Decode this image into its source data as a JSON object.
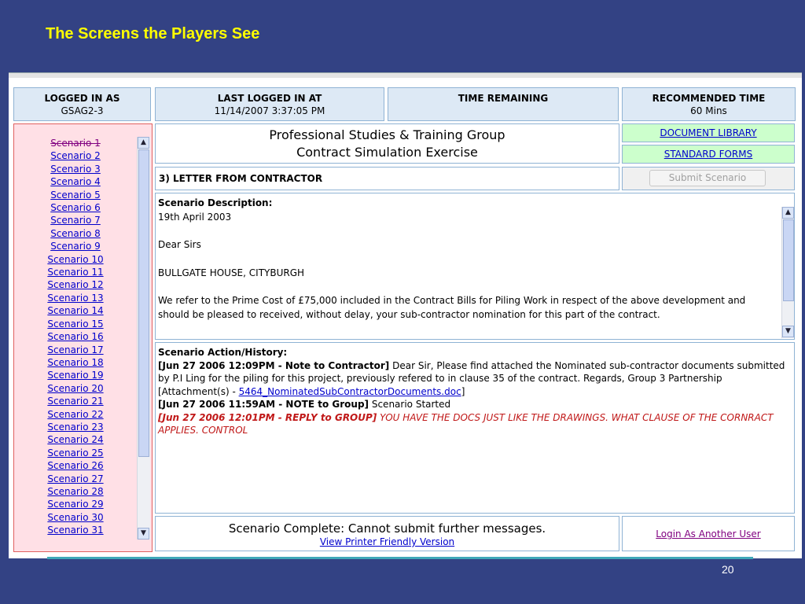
{
  "slide": {
    "title": "The Screens the Players See",
    "page_number": "20"
  },
  "header": {
    "logged_in_as": {
      "label": "LOGGED IN AS",
      "value": "GSAG2-3"
    },
    "last_logged_in": {
      "label": "LAST LOGGED IN AT",
      "value": "11/14/2007 3:37:05 PM"
    },
    "time_remaining": {
      "label": "TIME REMAINING",
      "value": ""
    },
    "recommended_time": {
      "label": "RECOMMENDED TIME",
      "value": "60 Mins"
    }
  },
  "sidebar": {
    "scenarios": [
      "Scenario 1",
      "Scenario 2",
      "Scenario 3",
      "Scenario 4",
      "Scenario 5",
      "Scenario 6",
      "Scenario 7",
      "Scenario 8",
      "Scenario 9",
      "Scenario 10",
      "Scenario 11",
      "Scenario 12",
      "Scenario 13",
      "Scenario 14",
      "Scenario 15",
      "Scenario 16",
      "Scenario 17",
      "Scenario 18",
      "Scenario 19",
      "Scenario 20",
      "Scenario 21",
      "Scenario 22",
      "Scenario 23",
      "Scenario 24",
      "Scenario 25",
      "Scenario 26",
      "Scenario 27",
      "Scenario 28",
      "Scenario 29",
      "Scenario 30",
      "Scenario 31"
    ]
  },
  "main": {
    "title_line1": "Professional Studies & Training Group",
    "title_line2": "Contract Simulation Exercise",
    "letter_heading": "3) LETTER FROM CONTRACTOR",
    "description": {
      "heading": "Scenario Description:",
      "date": "19th April 2003",
      "salutation": "Dear Sirs",
      "subject": "BULLGATE HOUSE, CITYBURGH",
      "body": "We refer to the Prime Cost of £75,000 included in the Contract Bills for Piling Work in respect of the above development and should be pleased to received, without delay, your sub-contractor nomination for this part of the contract."
    },
    "history": {
      "heading": "Scenario Action/History:",
      "entry1_head": "[Jun 27 2006 12:09PM - Note to Contractor]",
      "entry1_text": " Dear Sir, Please find attached the Nominated sub-contractor documents submitted by P.I Ling for the piling for this project, previously refered to in clause 35 of the contract. Regards, Group 3 Partnership",
      "attachment_prefix": "[Attachment(s) - ",
      "attachment_link": "5464_NominatedSubContractorDocuments.doc",
      "attachment_suffix": "]",
      "entry2_head": "[Jun 27 2006 11:59AM - NOTE to Group]",
      "entry2_text": " Scenario Started",
      "entry3_head": "[Jun 27 2006 12:01PM - REPLY to GROUP]",
      "entry3_text": " YOU HAVE THE DOCS JUST LIKE THE DRAWINGS. WHAT CLAUSE OF THE CORNRACT APPLIES. CONTROL"
    },
    "complete_message": "Scenario Complete: Cannot submit further messages.",
    "printer_link": "View Printer Friendly Version"
  },
  "right": {
    "document_library": "DOCUMENT LIBRARY",
    "standard_forms": "STANDARD FORMS",
    "submit_button": "Submit Scenario",
    "login_another": "Login As Another User"
  }
}
